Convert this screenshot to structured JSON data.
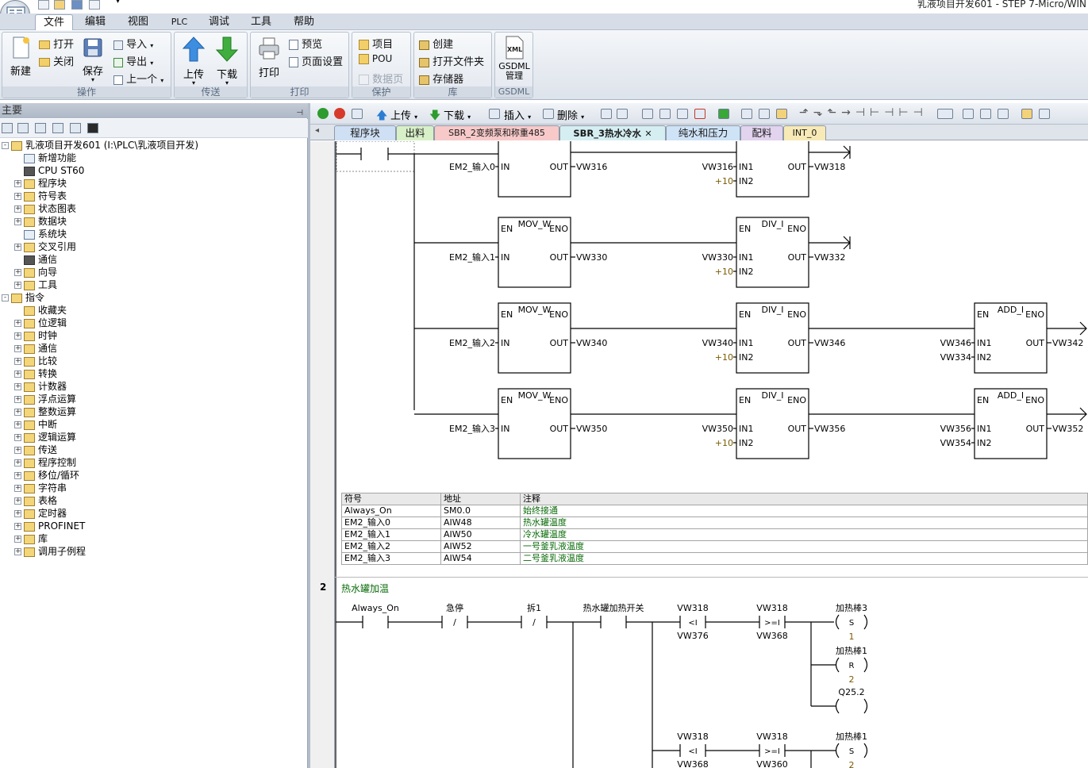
{
  "window": {
    "title": "乳液项目开发601 - STEP 7-Micro/WIN"
  },
  "menu": [
    "文件",
    "编辑",
    "视图",
    "PLC",
    "调试",
    "工具",
    "帮助"
  ],
  "ribbon": {
    "groups": {
      "operate": {
        "label": "操作",
        "new": "新建",
        "open": "打开",
        "close": "关闭",
        "save": "保存",
        "import": "导入",
        "export": "导出",
        "prev": "上一个"
      },
      "transfer": {
        "label": "传送",
        "upload": "上传",
        "download": "下载"
      },
      "print": {
        "label": "打印",
        "print": "打印",
        "preview": "预览",
        "page_setup": "页面设置"
      },
      "protect": {
        "label": "保护",
        "project": "项目",
        "pou": "POU",
        "datapage": "数据页"
      },
      "library": {
        "label": "库",
        "create": "创建",
        "open_folder": "打开文件夹",
        "memory": "存储器"
      },
      "gsdml": {
        "label": "GSDML",
        "manage": "GSDML\n管理",
        "xml": "XML"
      }
    }
  },
  "left_panel": {
    "title": "主要",
    "tree": [
      {
        "label": "乳液项目开发601 (I:\\PLC\\乳液项目开发)",
        "level": 0,
        "exp": "-",
        "icon": "project-icon"
      },
      {
        "label": "新增功能",
        "level": 1,
        "exp": "",
        "icon": "help-icon"
      },
      {
        "label": "CPU ST60",
        "level": 1,
        "exp": "",
        "icon": "cpu-icon"
      },
      {
        "label": "程序块",
        "level": 1,
        "exp": "+",
        "icon": "folder-icon"
      },
      {
        "label": "符号表",
        "level": 1,
        "exp": "+",
        "icon": "folder-icon"
      },
      {
        "label": "状态图表",
        "level": 1,
        "exp": "+",
        "icon": "folder-icon"
      },
      {
        "label": "数据块",
        "level": 1,
        "exp": "+",
        "icon": "folder-icon"
      },
      {
        "label": "系统块",
        "level": 1,
        "exp": "",
        "icon": "doc-icon"
      },
      {
        "label": "交叉引用",
        "level": 1,
        "exp": "+",
        "icon": "folder-icon"
      },
      {
        "label": "通信",
        "level": 1,
        "exp": "",
        "icon": "monitor-icon"
      },
      {
        "label": "向导",
        "level": 1,
        "exp": "+",
        "icon": "wand-icon"
      },
      {
        "label": "工具",
        "level": 1,
        "exp": "+",
        "icon": "folder-icon"
      },
      {
        "label": "指令",
        "level": 0,
        "exp": "-",
        "icon": "folder-icon"
      },
      {
        "label": "收藏夹",
        "level": 1,
        "exp": "",
        "icon": "folder-icon"
      },
      {
        "label": "位逻辑",
        "level": 1,
        "exp": "+",
        "icon": "folder-icon"
      },
      {
        "label": "时钟",
        "level": 1,
        "exp": "+",
        "icon": "clock-icon"
      },
      {
        "label": "通信",
        "level": 1,
        "exp": "+",
        "icon": "folder-icon"
      },
      {
        "label": "比较",
        "level": 1,
        "exp": "+",
        "icon": "folder-icon"
      },
      {
        "label": "转换",
        "level": 1,
        "exp": "+",
        "icon": "folder-icon"
      },
      {
        "label": "计数器",
        "level": 1,
        "exp": "+",
        "icon": "folder-icon"
      },
      {
        "label": "浮点运算",
        "level": 1,
        "exp": "+",
        "icon": "folder-icon"
      },
      {
        "label": "整数运算",
        "level": 1,
        "exp": "+",
        "icon": "folder-icon"
      },
      {
        "label": "中断",
        "level": 1,
        "exp": "+",
        "icon": "folder-icon"
      },
      {
        "label": "逻辑运算",
        "level": 1,
        "exp": "+",
        "icon": "folder-icon"
      },
      {
        "label": "传送",
        "level": 1,
        "exp": "+",
        "icon": "folder-icon"
      },
      {
        "label": "程序控制",
        "level": 1,
        "exp": "+",
        "icon": "folder-icon"
      },
      {
        "label": "移位/循环",
        "level": 1,
        "exp": "+",
        "icon": "folder-icon"
      },
      {
        "label": "字符串",
        "level": 1,
        "exp": "+",
        "icon": "folder-icon"
      },
      {
        "label": "表格",
        "level": 1,
        "exp": "+",
        "icon": "folder-icon"
      },
      {
        "label": "定时器",
        "level": 1,
        "exp": "+",
        "icon": "folder-icon"
      },
      {
        "label": "PROFINET",
        "level": 1,
        "exp": "+",
        "icon": "folder-icon"
      },
      {
        "label": "库",
        "level": 1,
        "exp": "+",
        "icon": "folder-icon"
      },
      {
        "label": "调用子例程",
        "level": 1,
        "exp": "+",
        "icon": "folder-icon"
      }
    ]
  },
  "editor_toolbar": {
    "upload": "上传",
    "download": "下载",
    "insert": "插入",
    "delete": "删除"
  },
  "tabs": [
    {
      "label": "程序块",
      "color": "#cfe0f5"
    },
    {
      "label": "出料",
      "color": "#d8f0c8"
    },
    {
      "label": "SBR_2变频泵和称重485",
      "color": "#f7c9c9"
    },
    {
      "label": "SBR_3热水冷水",
      "color": "#d5eef2",
      "active": true
    },
    {
      "label": "纯水和压力",
      "color": "#cfe3f7"
    },
    {
      "label": "配料",
      "color": "#e2d3ef"
    },
    {
      "label": "INT_0",
      "color": "#f7eab6"
    }
  ],
  "network1": {
    "rows": [
      {
        "input": "EM2_输入0",
        "mov_out": "VW316",
        "div_in1": "VW316",
        "div_in2": "+10",
        "div_out": "VW318"
      },
      {
        "input": "EM2_输入1",
        "mov_out": "VW330",
        "div_in1": "VW330",
        "div_in2": "+10",
        "div_out": "VW332"
      },
      {
        "input": "EM2_输入2",
        "mov_out": "VW340",
        "div_in1": "VW340",
        "div_in2": "+10",
        "div_out": "VW346",
        "add_in1": "VW346",
        "add_in2": "VW334",
        "add_out": "VW342"
      },
      {
        "input": "EM2_输入3",
        "mov_out": "VW350",
        "div_in1": "VW350",
        "div_in2": "+10",
        "div_out": "VW356",
        "add_in1": "VW356",
        "add_in2": "VW354",
        "add_out": "VW352"
      }
    ],
    "box": {
      "mov": "MOV_W",
      "div": "DIV_I",
      "add": "ADD_I",
      "en": "EN",
      "eno": "ENO",
      "in": "IN",
      "out": "OUT",
      "in1": "IN1",
      "in2": "IN2"
    }
  },
  "symbol_table": {
    "headers": [
      "符号",
      "地址",
      "注释"
    ],
    "rows": [
      [
        "Always_On",
        "SM0.0",
        "始终接通"
      ],
      [
        "EM2_输入0",
        "AIW48",
        "热水罐温度"
      ],
      [
        "EM2_输入1",
        "AIW50",
        "冷水罐温度"
      ],
      [
        "EM2_输入2",
        "AIW52",
        "一号釜乳液温度"
      ],
      [
        "EM2_输入3",
        "AIW54",
        "二号釜乳液温度"
      ]
    ]
  },
  "network2": {
    "number": "2",
    "title": "热水罐加温",
    "contacts": {
      "always_on": "Always_On",
      "estop": "急停",
      "estop_sym": "/",
      "c3": "拆1",
      "c3_sym": "/",
      "c4": "热水罐加热开关"
    },
    "cmp1": {
      "top": "VW318",
      "op": "<I",
      "bottom": "VW376"
    },
    "cmp2": {
      "top": "VW318",
      "op": ">=I",
      "bottom": "VW368"
    },
    "cmp3": {
      "top": "VW318",
      "op": "<I",
      "bottom": "VW368"
    },
    "cmp4": {
      "top": "VW318",
      "op": ">=I",
      "bottom": "VW360"
    },
    "coil1": {
      "name": "加热棒3",
      "type": "S",
      "n": "1"
    },
    "coil2": {
      "name": "加热棒1",
      "type": "R",
      "n": "2"
    },
    "coil3": {
      "name": "Q25.2"
    },
    "coil4": {
      "name": "加热棒1",
      "type": "S",
      "n": "2"
    }
  }
}
